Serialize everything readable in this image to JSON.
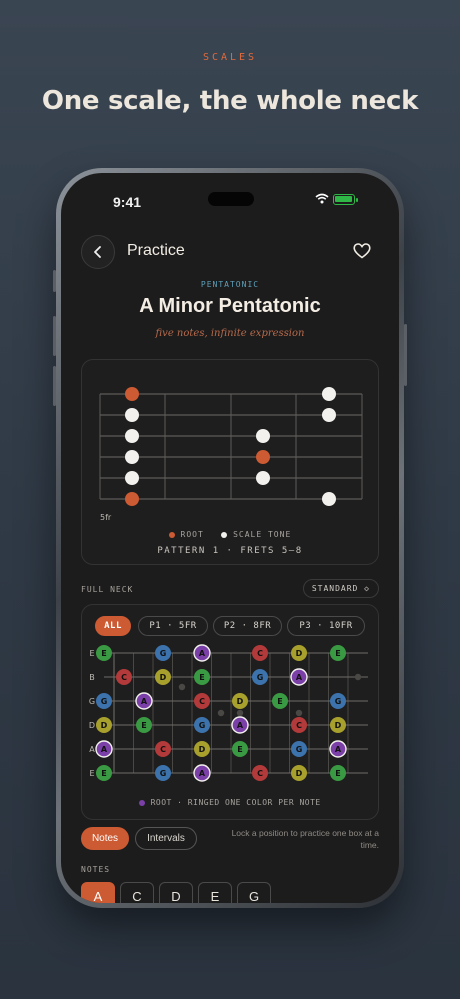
{
  "page": {
    "eyebrow": "SCALES",
    "headline": "One scale, the whole neck"
  },
  "status": {
    "time": "9:41"
  },
  "nav": {
    "title": "Practice"
  },
  "header": {
    "kicker": "PENTATONIC",
    "title": "A Minor Pentatonic",
    "subtitle": "five notes, infinite expression"
  },
  "box": {
    "fret_label": "5fr",
    "legend_root": "ROOT",
    "legend_tone": "SCALE TONE",
    "pattern": "PATTERN 1 · FRETS 5–8"
  },
  "full_neck": {
    "label": "FULL NECK",
    "tuning": "STANDARD ◇",
    "chips": [
      "ALL",
      "P1 · 5FR",
      "P2 · 8FR",
      "P3 · 10FR"
    ],
    "string_names": [
      "E",
      "B",
      "G",
      "D",
      "A",
      "E"
    ],
    "legend": "ROOT · RINGED  ONE COLOR PER NOTE"
  },
  "mode": {
    "notes": "Notes",
    "intervals": "Intervals"
  },
  "hint": "Lock a position to practice one box at a time.",
  "notes": {
    "label": "NOTES",
    "items": [
      "A",
      "C",
      "D",
      "E",
      "G"
    ]
  },
  "colors": {
    "accent": "#cc5a32",
    "A": "#7b3fa8",
    "C": "#b33a3a",
    "D": "#a8a02d",
    "E": "#3a9a43",
    "G": "#3c73ad"
  }
}
